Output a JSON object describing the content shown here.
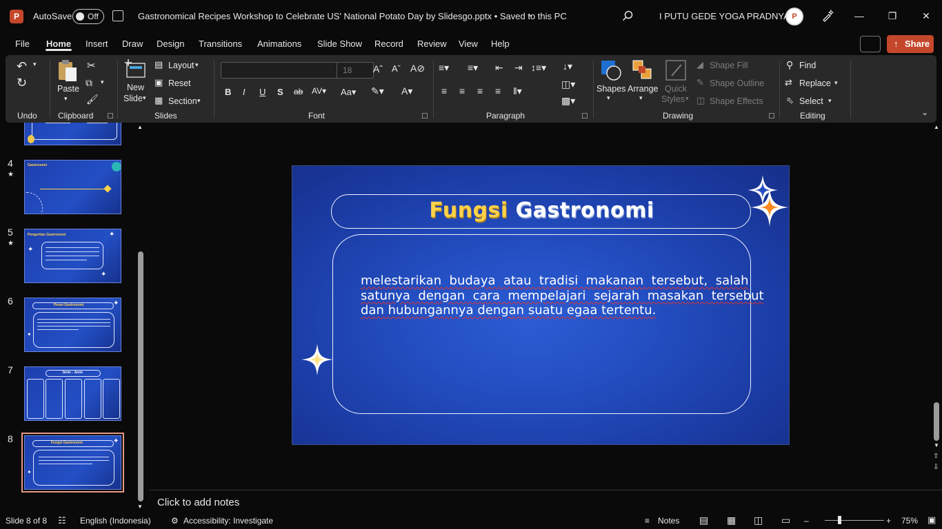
{
  "titlebar": {
    "app_letter": "P",
    "autosave_label": "AutoSave",
    "autosave_state": "Off",
    "document_title": "Gastronomical Recipes Workshop to Celebrate US' National Potato Day by Slidesgo.pptx • Saved to this PC",
    "user_name": "I PUTU GEDE YOGA PRADNYANA"
  },
  "menu": {
    "items": [
      "File",
      "Home",
      "Insert",
      "Draw",
      "Design",
      "Transitions",
      "Animations",
      "Slide Show",
      "Record",
      "Review",
      "View",
      "Help"
    ],
    "active": "Home",
    "share_label": "Share"
  },
  "ribbon": {
    "undo_label": "Undo",
    "clipboard": {
      "paste": "Paste",
      "label": "Clipboard"
    },
    "slides": {
      "new_slide": "New",
      "new_slide_2": "Slide",
      "layout": "Layout",
      "reset": "Reset",
      "section": "Section",
      "label": "Slides"
    },
    "font": {
      "font_name": "",
      "font_size": "18",
      "label": "Font"
    },
    "paragraph": {
      "label": "Paragraph"
    },
    "drawing": {
      "shapes": "Shapes",
      "arrange": "Arrange",
      "quick_styles": "Quick",
      "quick_styles_2": "Styles",
      "shape_fill": "Shape Fill",
      "shape_outline": "Shape Outline",
      "shape_effects": "Shape Effects",
      "label": "Drawing"
    },
    "editing": {
      "find": "Find",
      "replace": "Replace",
      "select": "Select",
      "label": "Editing"
    }
  },
  "thumbnails": [
    {
      "number": "4",
      "star": true,
      "title": "Gastronomi"
    },
    {
      "number": "5",
      "star": true,
      "title": "Pengertian Gastronomi"
    },
    {
      "number": "6",
      "star": false,
      "title": "Peran Gastronomi"
    },
    {
      "number": "7",
      "star": false,
      "title": "Jenis - Jenis"
    },
    {
      "number": "8",
      "star": false,
      "title": "Fungsi Gastronomi",
      "selected": true
    }
  ],
  "slide": {
    "title_part1": "Fungsi",
    "title_part2": "Gastronomi",
    "body_line1": "melestarikan  budaya  atau  tradisi  makanan  tersebut,  salah",
    "body_line2": "satunya  dengan  cara  mempelajari  sejarah  masakan  tersebut",
    "body_line3": "dan hubungannya dengan suatu egaa tertentu."
  },
  "notes": {
    "placeholder": "Click to add notes"
  },
  "statusbar": {
    "slide_count": "Slide 8 of 8",
    "language": "English (Indonesia)",
    "accessibility": "Accessibility: Investigate",
    "notes": "Notes",
    "zoom": "75%"
  },
  "colors": {
    "accent": "#c4472b",
    "slide_bg": "#2450c4",
    "title_yellow": "#ffd24a"
  }
}
